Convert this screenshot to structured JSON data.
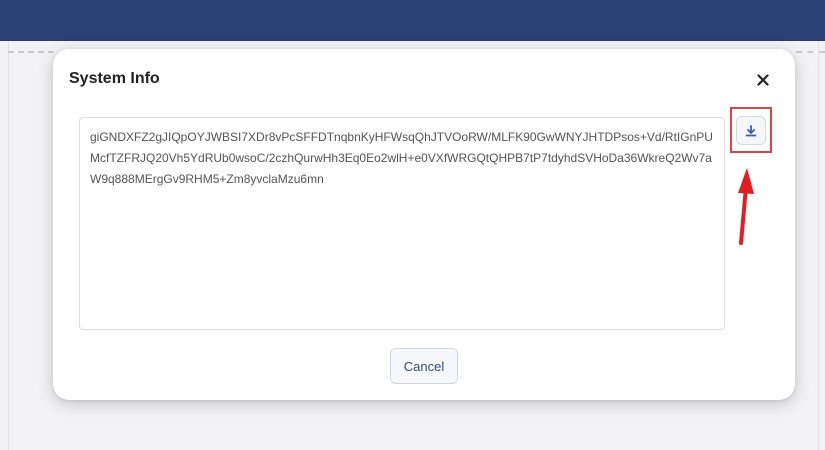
{
  "modal": {
    "title": "System Info",
    "content": "giGNDXFZ2gJIQpOYJWBSI7XDr8vPcSFFDTnqbnKyHFWsqQhJTVOoRW/MLFK90GwWNYJHTDPsos+Vd/RtIGnPUMcfTZFRJQ20Vh5YdRUb0wsoC/2czhQurwHh3Eq0Eo2wlH+e0VXfWRGQtQHPB7tP7tdyhdSVHoDa36WkreQ2Wv7aW9q888MErgGv9RHM5+Zm8yvclaMzu6mn",
    "cancel_label": "Cancel"
  },
  "icons": {
    "close": "close-icon",
    "download": "download-icon",
    "annotation": "red-arrow"
  },
  "colors": {
    "topbar": "#2a4072",
    "highlight": "#e0424a",
    "arrow": "#e41e1e",
    "accent": "#3b5bb5"
  }
}
